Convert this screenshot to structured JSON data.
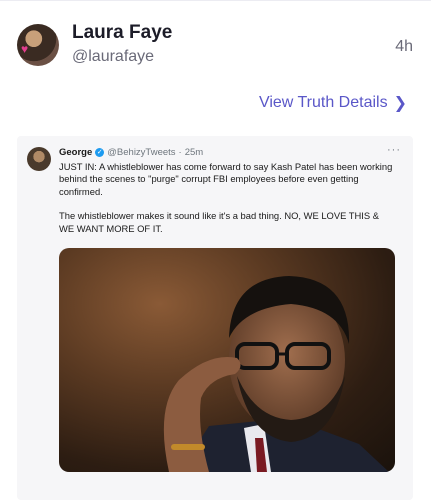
{
  "post": {
    "display_name": "Laura Faye",
    "handle": "@laurafaye",
    "time": "4h",
    "view_details_label": "View Truth Details"
  },
  "embedded_tweet": {
    "name": "George",
    "handle": "@BehizyTweets",
    "separator": "·",
    "time": "25m",
    "more_label": "···",
    "paragraphs": [
      "JUST IN: A whistleblower has come forward to say Kash Patel has been working behind the scenes to \"purge\" corrupt FBI employees before even getting confirmed.",
      "The whistleblower makes it sound like it's a bad thing. NO, WE LOVE THIS & WE WANT MORE OF IT."
    ]
  },
  "icons": {
    "verified": "verified-badge-icon",
    "chevron": "chevron-right-icon"
  },
  "colors": {
    "accent": "#5a57c8",
    "verified": "#1d9bf0"
  }
}
